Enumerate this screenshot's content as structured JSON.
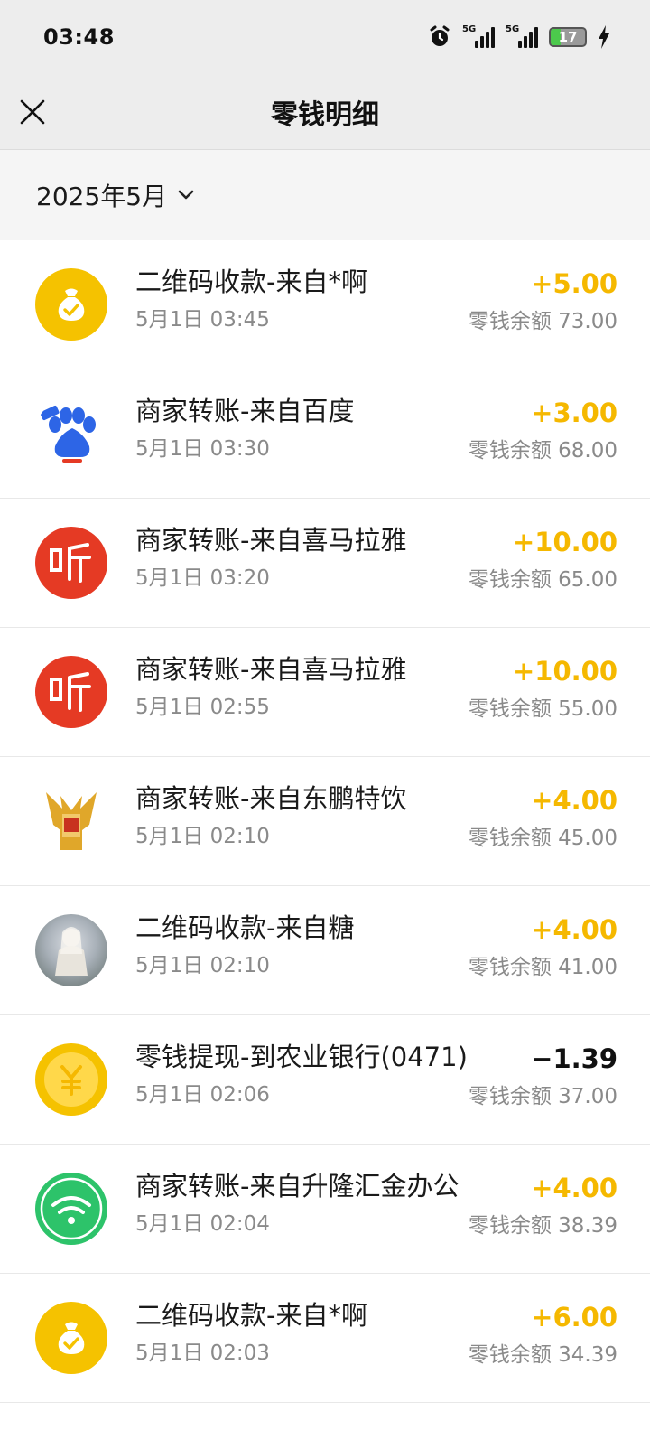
{
  "status": {
    "time": "03:48",
    "battery": "17",
    "net1": "5G",
    "net2": "5G"
  },
  "nav": {
    "title": "零钱明细"
  },
  "filter": {
    "month": "2025年5月"
  },
  "colors": {
    "income": "#f5b800",
    "expense": "#111111",
    "yellow_icon": "#f5c200",
    "ximalaya": "#e53a24",
    "wifi": "#2dc36a"
  },
  "transactions": [
    {
      "icon": "money-bag-icon",
      "title": "二维码收款-来自*啊",
      "time": "5月1日 03:45",
      "amount": "+5.00",
      "balance": "零钱余额 73.00"
    },
    {
      "icon": "baidu-icon",
      "title": "商家转账-来自百度",
      "time": "5月1日 03:30",
      "amount": "+3.00",
      "balance": "零钱余额 68.00"
    },
    {
      "icon": "ximalaya-icon",
      "title": "商家转账-来自喜马拉雅",
      "time": "5月1日 03:20",
      "amount": "+10.00",
      "balance": "零钱余额 65.00"
    },
    {
      "icon": "ximalaya-icon",
      "title": "商家转账-来自喜马拉雅",
      "time": "5月1日 02:55",
      "amount": "+10.00",
      "balance": "零钱余额 55.00"
    },
    {
      "icon": "dongpeng-icon",
      "title": "商家转账-来自东鹏特饮",
      "time": "5月1日 02:10",
      "amount": "+4.00",
      "balance": "零钱余额 45.00"
    },
    {
      "icon": "user-avatar",
      "title": "二维码收款-来自糖",
      "time": "5月1日 02:10",
      "amount": "+4.00",
      "balance": "零钱余额 41.00"
    },
    {
      "icon": "yuan-coin-icon",
      "title": "零钱提现-到农业银行(0471)",
      "time": "5月1日 02:06",
      "amount": "−1.39",
      "balance": "零钱余额 37.00"
    },
    {
      "icon": "wifi-icon",
      "title": "商家转账-来自升隆汇金办公",
      "time": "5月1日 02:04",
      "amount": "+4.00",
      "balance": "零钱余额 38.39"
    },
    {
      "icon": "money-bag-icon",
      "title": "二维码收款-来自*啊",
      "time": "5月1日 02:03",
      "amount": "+6.00",
      "balance": "零钱余额 34.39"
    }
  ]
}
